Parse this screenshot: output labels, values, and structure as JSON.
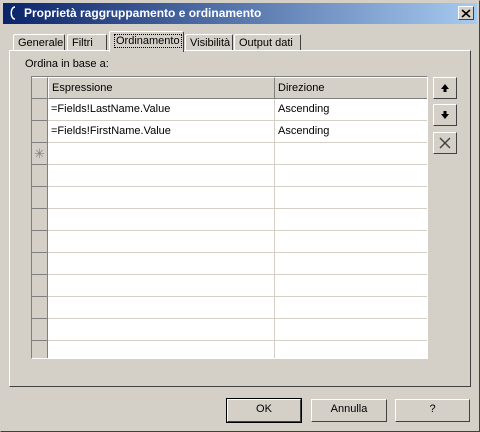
{
  "window": {
    "title": "Proprietà raggruppamento e ordinamento",
    "close_symbol": "✕"
  },
  "tabs": [
    {
      "label": "Generale",
      "active": false
    },
    {
      "label": "Filtri",
      "active": false
    },
    {
      "label": "Ordinamento",
      "active": true
    },
    {
      "label": "Visibilità",
      "active": false
    },
    {
      "label": "Output dati",
      "active": false
    }
  ],
  "sort": {
    "section_label": "Ordina in base a:",
    "columns": [
      "Espressione",
      "Direzione"
    ],
    "rows": [
      {
        "expression": "=Fields!LastName.Value",
        "direction": "Ascending"
      },
      {
        "expression": "=Fields!FirstName.Value",
        "direction": "Ascending"
      }
    ],
    "new_row_marker": "✳"
  },
  "side_buttons": [
    {
      "name": "move-up-button",
      "icon": "arrow-up-icon"
    },
    {
      "name": "move-down-button",
      "icon": "arrow-down-icon"
    },
    {
      "name": "delete-button",
      "icon": "delete-x-icon"
    }
  ],
  "footer": {
    "ok_label": "OK",
    "cancel_label": "Annulla",
    "help_label": "?"
  }
}
